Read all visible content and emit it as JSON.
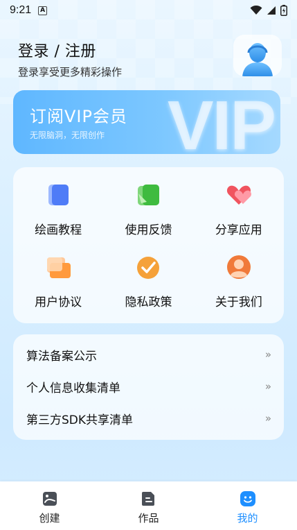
{
  "status_bar": {
    "time": "9:21",
    "notification_glyph": "A"
  },
  "header": {
    "login_title": "登录 / 注册",
    "login_subtitle": "登录享受更多精彩操作"
  },
  "vip": {
    "title": "订阅VIP会员",
    "subtitle": "无限脑洞，无限创作",
    "watermark": "VIP"
  },
  "menu": {
    "items": [
      {
        "label": "绘画教程",
        "icon": "book-icon"
      },
      {
        "label": "使用反馈",
        "icon": "feedback-icon"
      },
      {
        "label": "分享应用",
        "icon": "heart-icon"
      },
      {
        "label": "用户协议",
        "icon": "chat-bubble-icon"
      },
      {
        "label": "隐私政策",
        "icon": "check-circle-icon"
      },
      {
        "label": "关于我们",
        "icon": "person-icon"
      }
    ]
  },
  "links": {
    "items": [
      {
        "label": "算法备案公示",
        "arrow": "»"
      },
      {
        "label": "个人信息收集清单",
        "arrow": "»"
      },
      {
        "label": "第三方SDK共享清单",
        "arrow": "»"
      }
    ]
  },
  "tabbar": {
    "tabs": [
      {
        "label": "创建",
        "icon": "image-icon"
      },
      {
        "label": "作品",
        "icon": "document-icon"
      },
      {
        "label": "我的",
        "icon": "smiley-icon",
        "active": true
      }
    ]
  },
  "colors": {
    "accent": "#1e8fff",
    "vip_gradient_start": "#5fb7ff",
    "vip_gradient_end": "#a5d9ff"
  }
}
